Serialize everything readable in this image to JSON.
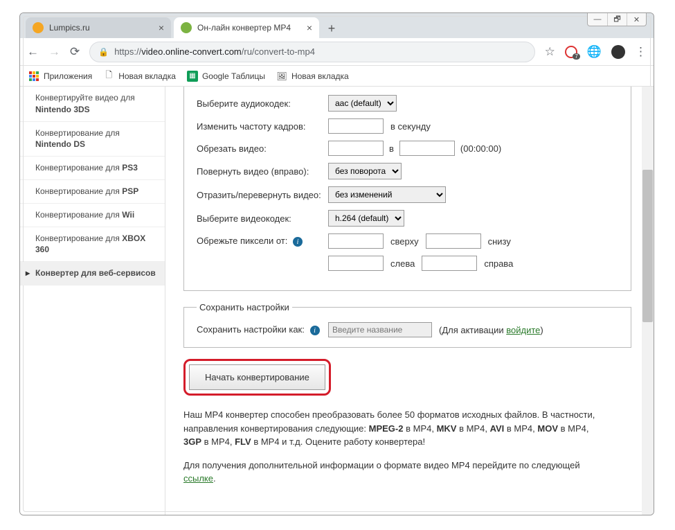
{
  "window": {
    "min": "—",
    "max": "🗗",
    "close": "✕"
  },
  "tabs": [
    {
      "title": "Lumpics.ru",
      "fav_bg": "#f5a623"
    },
    {
      "title": "Он-лайн конвертер MP4",
      "fav_bg": "#7cb342"
    }
  ],
  "newtab": "+",
  "nav": {
    "back": "←",
    "forward": "→",
    "reload": "⟳",
    "lock": "🔒"
  },
  "url": {
    "scheme": "https://",
    "host": "video.online-convert.com",
    "path": "/ru/convert-to-mp4"
  },
  "addr_icons": {
    "star": "☆",
    "ext_badge": "7",
    "globe": "🌐",
    "menu": "⋮"
  },
  "bookmarks_bar": {
    "apps": "Приложения",
    "items": [
      "Новая вкладка",
      "Google Таблицы",
      "Новая вкладка"
    ]
  },
  "sidebar": {
    "items": [
      {
        "prefix": "Конвертируйте видео для",
        "bold": "Nintendo 3DS"
      },
      {
        "prefix": "Конвертирование для",
        "bold": "Nintendo DS"
      },
      {
        "prefix": "Конвертирование для",
        "bold": "PS3"
      },
      {
        "prefix": "Конвертирование для",
        "bold": "PSP"
      },
      {
        "prefix": "Конвертирование для",
        "bold": "Wii"
      },
      {
        "prefix": "Конвертирование для",
        "bold": "XBOX 360"
      },
      {
        "prefix": "Конвертер для веб-сервисов",
        "bold": "",
        "active": true
      }
    ]
  },
  "form": {
    "audio_codec_label": "Выберите аудиокодек:",
    "audio_codec_value": "aac (default)",
    "framerate_label": "Изменить частоту кадров:",
    "framerate_suffix": "в секунду",
    "trim_label": "Обрезать видео:",
    "trim_mid": "в",
    "trim_hint": "(00:00:00)",
    "rotate_label": "Повернуть видео (вправо):",
    "rotate_value": "без поворота",
    "mirror_label": "Отразить/перевернуть видео:",
    "mirror_value": "без изменений",
    "video_codec_label": "Выберите видеокодек:",
    "video_codec_value": "h.264 (default)",
    "crop_label": "Обрежьте пиксели от:",
    "crop_top": "сверху",
    "crop_bottom": "снизу",
    "crop_left": "слева",
    "crop_right": "справа"
  },
  "save": {
    "legend": "Сохранить настройки",
    "label": "Сохранить настройки как:",
    "placeholder": "Введите название",
    "activation_prefix": "(Для активации ",
    "activation_link": "войдите",
    "activation_suffix": ")"
  },
  "convert_button": "Начать конвертирование",
  "blurb": {
    "p1_a": "Наш MP4 конвертер способен преобразовать более 50 форматов исходных файлов. В частности, направления конвертирования следующие: ",
    "mpeg2": "MPEG-2",
    "in1": " в MP4, ",
    "mkv": "MKV",
    "in2": " в MP4, ",
    "avi": "AVI",
    "in3": " в MP4, ",
    "mov": "MOV",
    "in4": " в MP4, ",
    "gp3": "3GP",
    "in5": " в MP4, ",
    "flv": "FLV",
    "p1_b": " в MP4 и т.д. Оцените работу конвертера!",
    "p2_a": "Для получения дополнительной информации о формате видео MP4 перейдите по следующей ",
    "p2_link": "ссылке",
    "p2_b": "."
  }
}
